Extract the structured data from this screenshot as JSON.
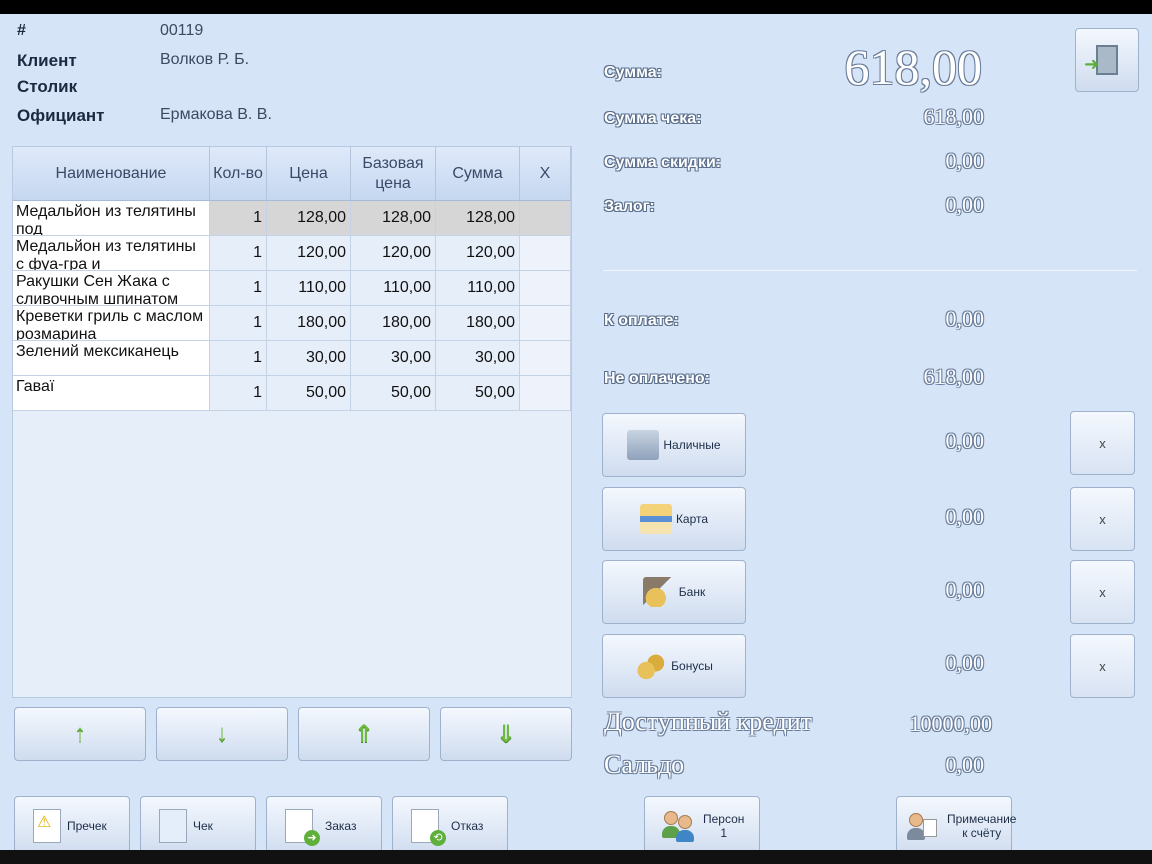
{
  "header": {
    "number_label": "#",
    "number_value": "00119",
    "client_label": "Клиент",
    "client_value": "Волков Р. Б.",
    "table_label": "Столик",
    "table_value": "",
    "waiter_label": "Официант",
    "waiter_value": "Ермакова В. В."
  },
  "table": {
    "columns": [
      "Наименование",
      "Кол-во",
      "Цена",
      "Базовая цена",
      "Сумма",
      "X"
    ],
    "rows": [
      {
        "name": "Медальйон из телятины под",
        "qty": "1",
        "price": "128,00",
        "base": "128,00",
        "sum": "128,00"
      },
      {
        "name": "Медальйон из телятины с фуа-гра и",
        "qty": "1",
        "price": "120,00",
        "base": "120,00",
        "sum": "120,00"
      },
      {
        "name": "Ракушки Сен Жака с сливочным шпинатом",
        "qty": "1",
        "price": "110,00",
        "base": "110,00",
        "sum": "110,00"
      },
      {
        "name": "Креветки гриль с маслом розмарина",
        "qty": "1",
        "price": "180,00",
        "base": "180,00",
        "sum": "180,00"
      },
      {
        "name": "Зелений мексиканець",
        "qty": "1",
        "price": "30,00",
        "base": "30,00",
        "sum": "30,00"
      },
      {
        "name": "Гаваї",
        "qty": "1",
        "price": "50,00",
        "base": "50,00",
        "sum": "50,00"
      }
    ]
  },
  "nav_buttons": [
    "arrow-up-icon",
    "arrow-down-icon",
    "page-up-icon",
    "page-down-icon"
  ],
  "bottom_buttons": {
    "precheck": "Пречек",
    "check": "Чек",
    "order": "Заказ",
    "refuse": "Отказ",
    "persons_line1": "Персон",
    "persons_line2": "1",
    "note_line1": "Примечание",
    "note_line2": "к счёту"
  },
  "summary": {
    "total_label": "Сумма:",
    "total_value": "618,00",
    "check_sum_label": "Сумма чека:",
    "check_sum_value": "618,00",
    "discount_label": "Сумма скидки:",
    "discount_value": "0,00",
    "deposit_label": "Залог:",
    "deposit_value": "0,00",
    "to_pay_label": "К оплате:",
    "to_pay_value": "0,00",
    "unpaid_label": "Не оплачено:",
    "unpaid_value": "618,00"
  },
  "payments": [
    {
      "label": "Наличные",
      "value": "0,00",
      "x": "x"
    },
    {
      "label": "Карта",
      "value": "0,00",
      "x": "x"
    },
    {
      "label": "Банк",
      "value": "0,00",
      "x": "x"
    },
    {
      "label": "Бонусы",
      "value": "0,00",
      "x": "x"
    }
  ],
  "credit": {
    "available_label": "Доступный кредит",
    "available_value": "10000,00",
    "balance_label": "Сальдо",
    "balance_value": "0,00"
  },
  "colors": {
    "background": "#d6e4f7",
    "accent_green": "#6dbb3e"
  }
}
